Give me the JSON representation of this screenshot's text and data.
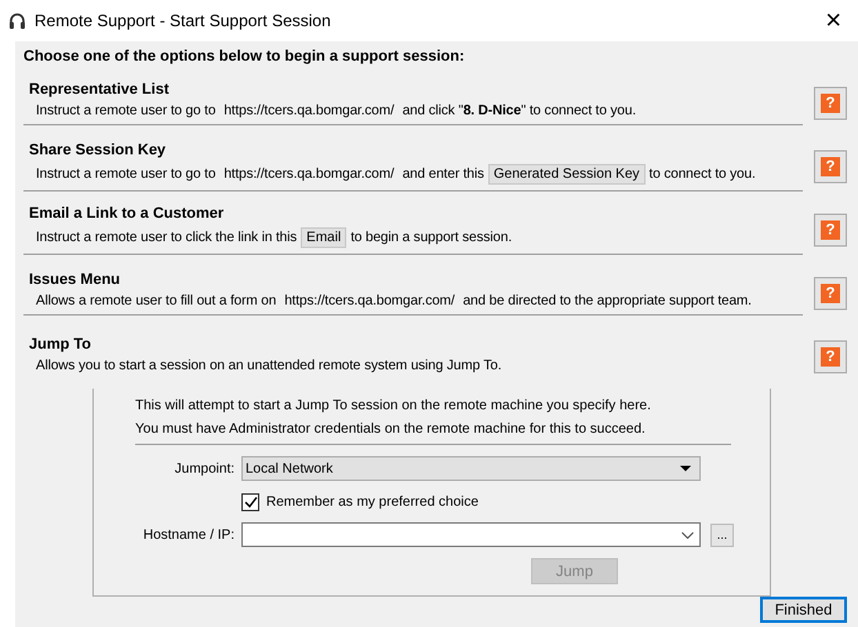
{
  "window": {
    "title": "Remote Support - Start Support Session",
    "close": "×"
  },
  "heading": "Choose one of the options below to begin a support session:",
  "sections": [
    {
      "title": "Representative List",
      "help": "?",
      "parts": [
        {
          "kind": "text",
          "text": "Instruct a remote user to go to"
        },
        {
          "kind": "url",
          "text": "https://tcers.qa.bomgar.com/"
        },
        {
          "kind": "text",
          "text": "and click \"**8. D-Nice**\" to connect to you."
        }
      ]
    },
    {
      "title": "Share Session Key",
      "help": "?",
      "parts": [
        {
          "kind": "text",
          "text": "Instruct a remote user to go to"
        },
        {
          "kind": "url",
          "text": "https://tcers.qa.bomgar.com/"
        },
        {
          "kind": "text",
          "text": "and enter this"
        },
        {
          "kind": "button",
          "text": "Generated Session Key"
        },
        {
          "kind": "text",
          "text": "to connect to you."
        }
      ]
    },
    {
      "title": "Email a Link to a Customer",
      "help": "?",
      "parts": [
        {
          "kind": "text",
          "text": "Instruct a remote user to click the link in this"
        },
        {
          "kind": "button",
          "text": "Email"
        },
        {
          "kind": "text",
          "text": "to begin a support session."
        }
      ]
    },
    {
      "title": "Issues Menu",
      "help": "?",
      "parts": [
        {
          "kind": "text",
          "text": "Allows a remote user to fill out a form on"
        },
        {
          "kind": "url",
          "text": "https://tcers.qa.bomgar.com/"
        },
        {
          "kind": "text",
          "text": "and be directed to the appropriate support team."
        }
      ]
    },
    {
      "title": "Jump To",
      "help": "?",
      "parts": [
        {
          "kind": "text",
          "text": "Allows you to start a session on an unattended remote system using Jump To."
        }
      ]
    }
  ],
  "jump": {
    "info": [
      "This will attempt to start a Jump To session on the remote machine you specify here.",
      "You must have Administrator credentials on the remote machine for this to succeed."
    ],
    "jumpoint_label": "Jumpoint:",
    "jumpoint": "Local Network",
    "remember": {
      "label": "Remember as my preferred choice",
      "checked": true
    },
    "hostname_label": "Hostname / IP:",
    "browse": "...",
    "jump_button": {
      "label": "Jump",
      "disabled": true
    }
  },
  "finished": "Finished"
}
